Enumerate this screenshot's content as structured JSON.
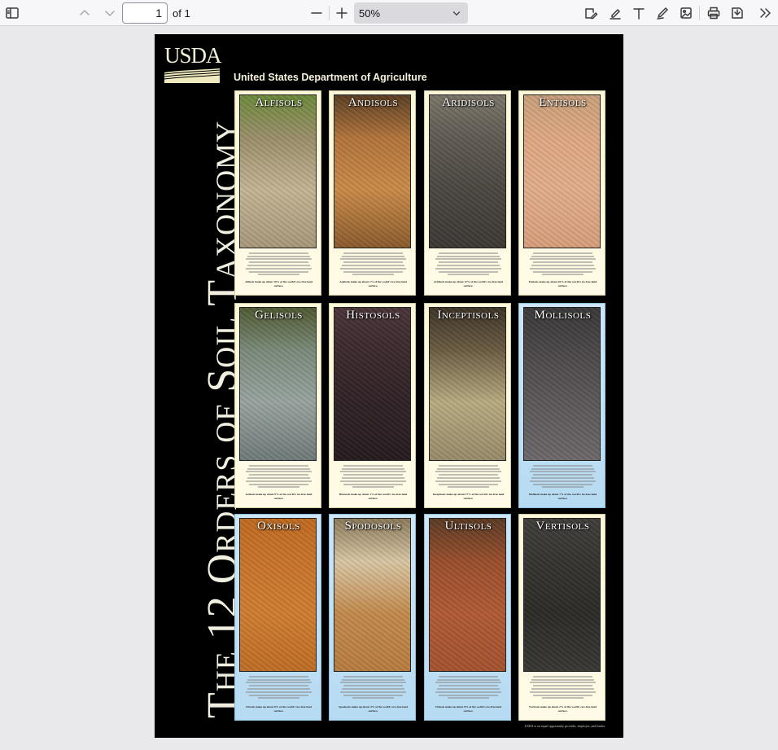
{
  "toolbar": {
    "page_number": "1",
    "page_count": "of 1",
    "zoom": "50%"
  },
  "icons": [
    "sidebar-icon",
    "arrow-up-icon",
    "arrow-down-icon",
    "minus-icon",
    "plus-icon",
    "chevron-down-icon",
    "sign-icon",
    "highlight-icon",
    "text-icon",
    "draw-icon",
    "image-icon",
    "print-icon",
    "save-icon",
    "more-icon"
  ],
  "poster": {
    "logo": "USDA",
    "department": "United States Department of Agriculture",
    "title": "The 12 Orders of Soil Taxonomy",
    "footer": "USDA is an equal opportunity provider, employer, and lender.",
    "soils": [
      {
        "name": "Alfisols",
        "stat": "Alfisols make up about 10% of the world's ice-free land surface.",
        "colors": [
          "#6c8a3a",
          "#9b8e6a",
          "#c4b494",
          "#a8987a"
        ],
        "card": "cream"
      },
      {
        "name": "Andisols",
        "stat": "Andisols make up about 1% of the world's ice-free land surface.",
        "colors": [
          "#5a3e22",
          "#b2743b",
          "#c98a47",
          "#8a5a2c"
        ],
        "card": "cream"
      },
      {
        "name": "Aridisols",
        "stat": "Aridisols make up about 12% of the world's ice-free land surface.",
        "colors": [
          "#7a7468",
          "#5f5a52",
          "#4a4640",
          "#3b3834"
        ],
        "card": "cream"
      },
      {
        "name": "Entisols",
        "stat": "Entisols make up about 16% of the world's ice-free land surface.",
        "colors": [
          "#c9a07a",
          "#e0a883",
          "#e2ad8b",
          "#d89e7c"
        ],
        "card": "cream"
      },
      {
        "name": "Gelisols",
        "stat": "Gelisols make up about 9% of the world's ice-free land surface.",
        "colors": [
          "#4e5a30",
          "#7b8a7a",
          "#98a3a0",
          "#6f7a78"
        ],
        "card": "cream"
      },
      {
        "name": "Histosols",
        "stat": "Histosols make up about 1% of the world's ice-free land surface.",
        "colors": [
          "#4a3438",
          "#3a282c",
          "#2f2125",
          "#241a1d"
        ],
        "card": "cream"
      },
      {
        "name": "Inceptisols",
        "stat": "Inceptisols make up about 17% of the world's ice-free land surface.",
        "colors": [
          "#3d3326",
          "#6a5c42",
          "#b7ab7f",
          "#968a68"
        ],
        "card": "cream"
      },
      {
        "name": "Mollisols",
        "stat": "Mollisols make up about 7% of the world's ice-free land surface.",
        "colors": [
          "#3a3738",
          "#4b4748",
          "#5c5758",
          "#6c6768"
        ],
        "card": "blue"
      },
      {
        "name": "Oxisols",
        "stat": "Oxisols make up about 8% of the world's ice-free land surface.",
        "colors": [
          "#c06a1f",
          "#c9742a",
          "#cf7d30",
          "#bf6d24"
        ],
        "card": "blue"
      },
      {
        "name": "Spodosols",
        "stat": "Spodosols make up about 4% of the world's ice-free land surface.",
        "colors": [
          "#8b7a5a",
          "#d8c6a4",
          "#c28a4c",
          "#b77c3f"
        ],
        "card": "blue"
      },
      {
        "name": "Ultisols",
        "stat": "Ultisols make up about 8% of the world's ice-free land surface.",
        "colors": [
          "#5a3a24",
          "#9a4e2c",
          "#b05a33",
          "#a3522e"
        ],
        "card": "blue"
      },
      {
        "name": "Vertisols",
        "stat": "Vertisols make up about 2% of the world's ice-free land surface.",
        "colors": [
          "#3f3d3a",
          "#35332f",
          "#2c2a27",
          "#383632"
        ],
        "card": "cream"
      }
    ]
  }
}
